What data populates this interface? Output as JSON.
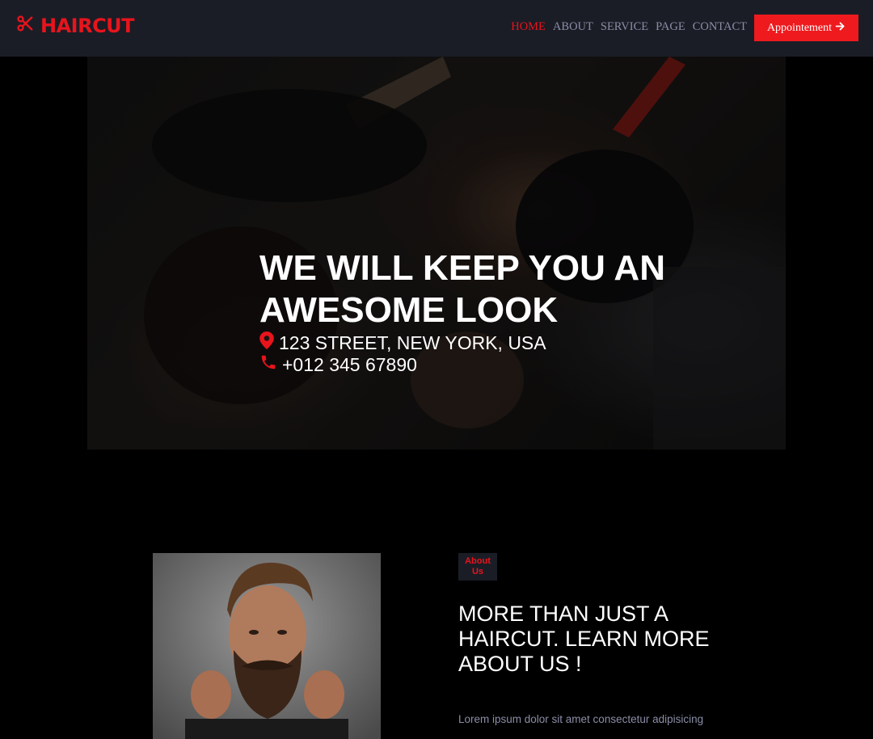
{
  "brand": {
    "name": "HAIRCUT",
    "icon": "scissors-icon",
    "color": "#e8141c"
  },
  "nav": {
    "links": [
      {
        "label": "HOME",
        "active": true
      },
      {
        "label": "ABOUT",
        "active": false
      },
      {
        "label": "SERVICE",
        "active": false
      },
      {
        "label": "PAGE",
        "active": false
      },
      {
        "label": "CONTACT",
        "active": false
      }
    ],
    "cta_label": "Appointement",
    "cta_icon": "arrow-right-icon"
  },
  "hero": {
    "title": "WE WILL KEEP YOU AN AWESOME LOOK",
    "address": "123 STREET, NEW YORK, USA",
    "address_icon": "map-marker-icon",
    "phone": "+012 345 67890",
    "phone_icon": "phone-icon"
  },
  "about": {
    "badge": "About Us",
    "title": "MORE THAN JUST A HAIRCUT. LEARN MORE ABOUT US !",
    "text": "Lorem ipsum dolor sit amet consectetur adipisicing"
  },
  "colors": {
    "accent": "#ee1a1e",
    "navbar_bg": "#1b1d26",
    "muted_text": "#8a8ea6",
    "page_bg": "#000000"
  }
}
